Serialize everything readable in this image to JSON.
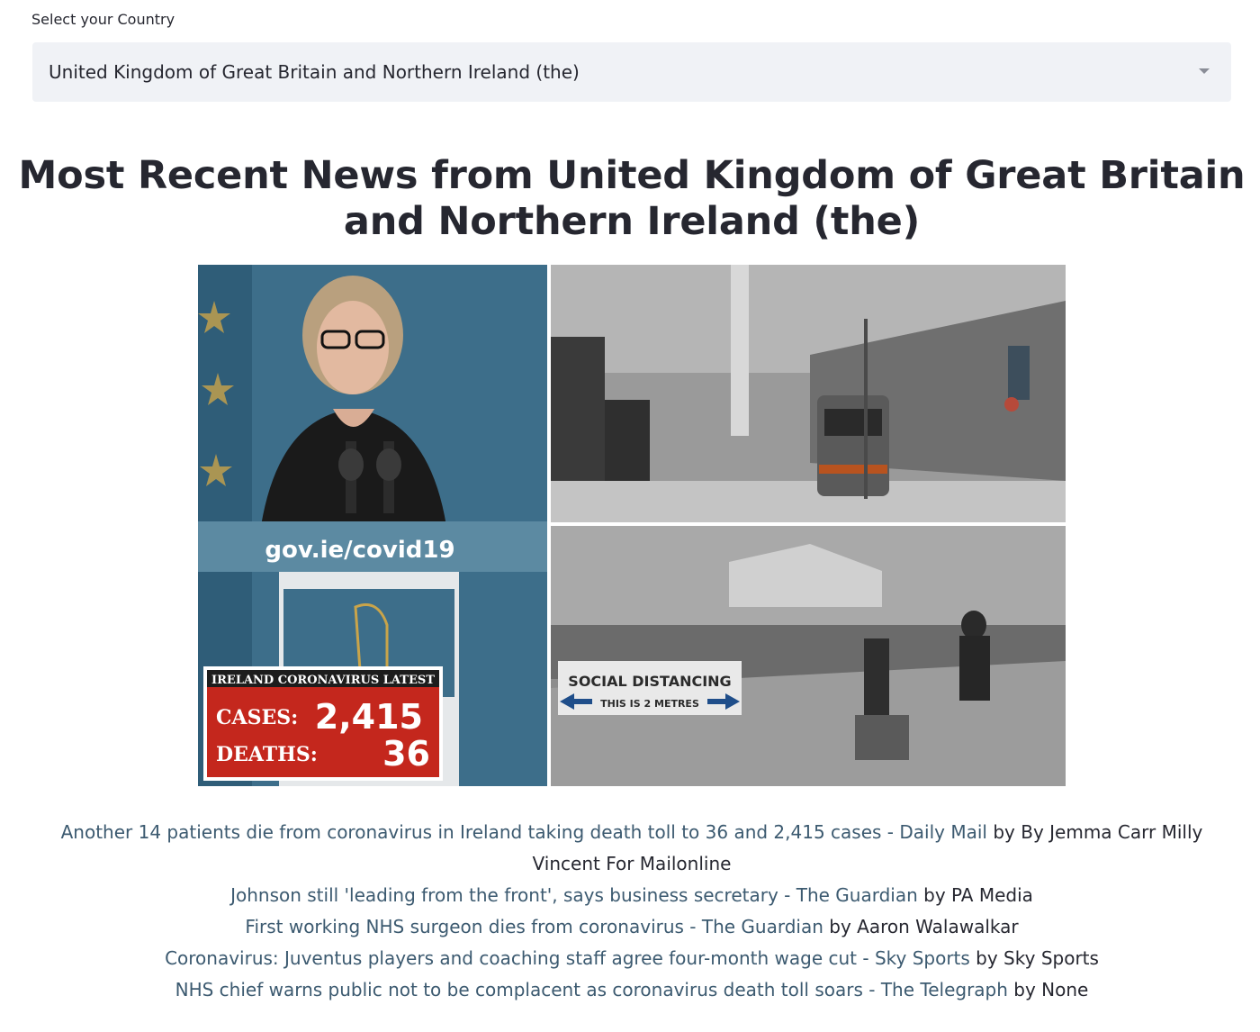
{
  "country_select": {
    "label": "Select your Country",
    "selected": "United Kingdom of Great Britain and Northern Ireland (the)"
  },
  "headline": "Most Recent News from United Kingdom of Great Britain and Northern Ireland (the)",
  "hero_image": {
    "podium_text": "gov.ie/covid19",
    "banner_title": "IRELAND CORONAVIRUS LATEST",
    "cases_label": "CASES:",
    "cases_value": "2,415",
    "deaths_label": "DEATHS:",
    "deaths_value": "36",
    "sign_title": "SOCIAL DISTANCING",
    "sign_subtitle": "THIS IS 2 METRES"
  },
  "news": [
    {
      "title": "Another 14 patients die from coronavirus in Ireland taking death toll to 36 and 2,415 cases - Daily Mail",
      "author": "by By Jemma Carr Milly Vincent For Mailonline"
    },
    {
      "title": "Johnson still 'leading from the front', says business secretary - The Guardian",
      "author": "by PA Media"
    },
    {
      "title": "First working NHS surgeon dies from coronavirus - The Guardian",
      "author": "by Aaron Walawalkar"
    },
    {
      "title": "Coronavirus: Juventus players and coaching staff agree four-month wage cut - Sky Sports",
      "author": "by Sky Sports"
    },
    {
      "title": "NHS chief warns public not to be complacent as coronavirus death toll soars - The Telegraph",
      "author": "by None"
    }
  ]
}
